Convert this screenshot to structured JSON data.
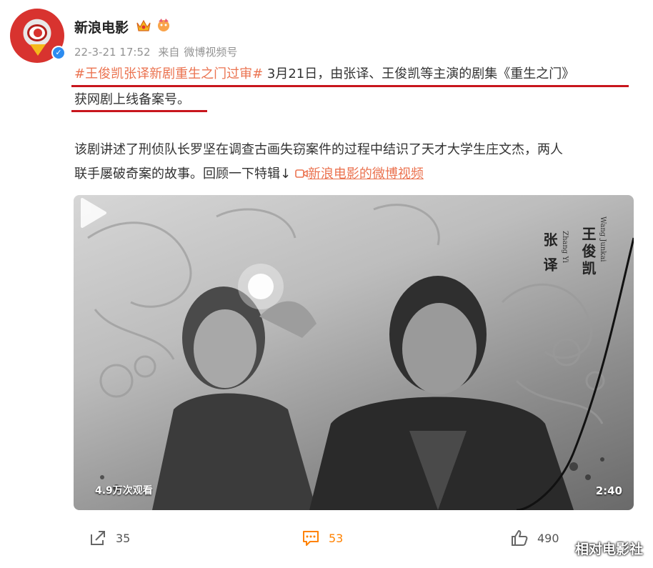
{
  "author": {
    "name": "新浪电影",
    "meta_date": "22-3-21 17:52",
    "meta_source_prefix": "来自",
    "meta_source": "微博视频号"
  },
  "post": {
    "topic": "#王俊凯张译新剧重生之门过审#",
    "line1_rest": " 3月21日，由张译、王俊凯等主演的剧集《重生之门》",
    "line2": "获网剧上线备案号。",
    "line3": "该剧讲述了刑侦队长罗坚在调查古画失窃案件的过程中结识了天才大学生庄文杰，两人",
    "line4_text": "联手屡破奇案的故事。回顾一下特辑↓",
    "video_link": "新浪电影的微博视频"
  },
  "video": {
    "views": "4.9万次观看",
    "duration": "2:40",
    "credit_left_cn": "张 译",
    "credit_left_en": "Zhang Yi",
    "credit_right_cn": "王俊凯",
    "credit_right_en": "Wang Junkai"
  },
  "actions": {
    "repost_count": "35",
    "comment_count": "53",
    "like_count": "490"
  },
  "watermark": "相对电影社",
  "colors": {
    "topic": "#eb7350",
    "underline": "#c8161d",
    "verify": "#2d8cf0"
  }
}
